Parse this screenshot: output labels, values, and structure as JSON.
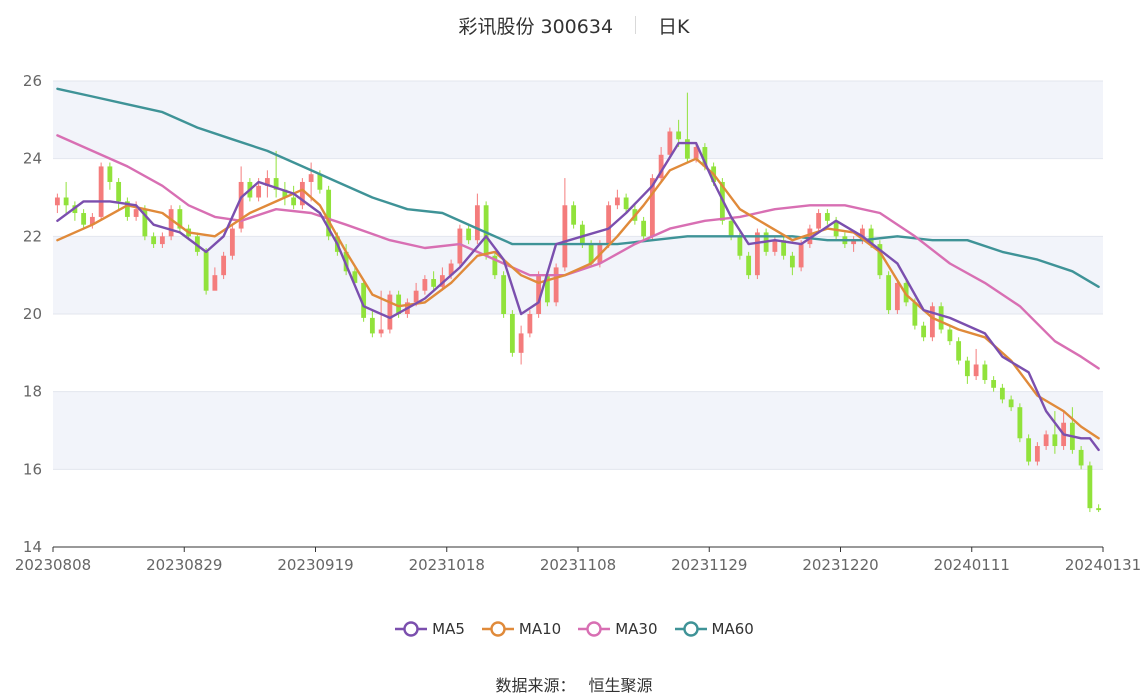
{
  "header": {
    "stock": "彩讯股份 300634",
    "period": "日K"
  },
  "source": {
    "label": "数据来源：",
    "provider": "恒生聚源"
  },
  "chart_data": {
    "type": "candlestick",
    "ylim": [
      14,
      26
    ],
    "yticks": [
      14,
      16,
      18,
      20,
      22,
      24,
      26
    ],
    "xticks": [
      "20230808",
      "20230829",
      "20230919",
      "20231018",
      "20231108",
      "20231129",
      "20231220",
      "20240111",
      "20240131"
    ],
    "n_candles": 120,
    "colors": {
      "up": "#f47c7c",
      "down": "#91e23b",
      "band": "#f2f4fa",
      "ma5": "#7b4fae",
      "ma10": "#e08a3a",
      "ma30": "#d86fb3",
      "ma60": "#3f9397"
    },
    "candles": [
      [
        22.8,
        23.0,
        22.6,
        23.1
      ],
      [
        23.0,
        22.8,
        22.6,
        23.4
      ],
      [
        22.8,
        22.6,
        22.4,
        22.9
      ],
      [
        22.6,
        22.3,
        22.2,
        22.7
      ],
      [
        22.3,
        22.5,
        22.2,
        22.6
      ],
      [
        22.5,
        23.8,
        22.4,
        23.9
      ],
      [
        23.8,
        23.4,
        23.2,
        23.9
      ],
      [
        23.4,
        22.9,
        22.7,
        23.5
      ],
      [
        22.9,
        22.5,
        22.4,
        23.0
      ],
      [
        22.5,
        22.7,
        22.4,
        22.9
      ],
      [
        22.7,
        22.0,
        21.9,
        22.8
      ],
      [
        22.0,
        21.8,
        21.7,
        22.1
      ],
      [
        21.8,
        22.0,
        21.7,
        22.1
      ],
      [
        22.0,
        22.7,
        21.9,
        22.8
      ],
      [
        22.7,
        22.2,
        22.1,
        22.8
      ],
      [
        22.2,
        22.0,
        21.9,
        22.3
      ],
      [
        22.0,
        21.6,
        21.5,
        22.1
      ],
      [
        21.6,
        20.6,
        20.5,
        21.7
      ],
      [
        20.6,
        21.0,
        20.9,
        21.2
      ],
      [
        21.0,
        21.5,
        20.9,
        21.6
      ],
      [
        21.5,
        22.2,
        21.4,
        22.3
      ],
      [
        22.2,
        23.4,
        22.1,
        23.8
      ],
      [
        23.4,
        23.0,
        22.9,
        23.5
      ],
      [
        23.0,
        23.3,
        22.9,
        23.5
      ],
      [
        23.3,
        23.5,
        23.0,
        23.7
      ],
      [
        23.5,
        23.2,
        23.0,
        24.2
      ],
      [
        23.2,
        23.0,
        22.8,
        23.4
      ],
      [
        23.0,
        22.8,
        22.7,
        23.3
      ],
      [
        22.8,
        23.4,
        22.7,
        23.5
      ],
      [
        23.4,
        23.6,
        22.9,
        23.9
      ],
      [
        23.6,
        23.2,
        23.1,
        23.7
      ],
      [
        23.2,
        22.0,
        21.9,
        23.3
      ],
      [
        22.0,
        21.6,
        21.5,
        22.1
      ],
      [
        21.6,
        21.1,
        21.0,
        21.8
      ],
      [
        21.1,
        20.8,
        20.7,
        21.2
      ],
      [
        20.8,
        19.9,
        19.8,
        20.9
      ],
      [
        19.9,
        19.5,
        19.4,
        20.1
      ],
      [
        19.5,
        19.6,
        19.4,
        20.6
      ],
      [
        19.6,
        20.5,
        19.5,
        20.6
      ],
      [
        20.5,
        20.0,
        19.9,
        20.6
      ],
      [
        20.0,
        20.3,
        19.9,
        20.4
      ],
      [
        20.3,
        20.6,
        20.2,
        20.8
      ],
      [
        20.6,
        20.9,
        20.5,
        21.0
      ],
      [
        20.9,
        20.7,
        20.6,
        21.1
      ],
      [
        20.7,
        21.0,
        20.6,
        21.2
      ],
      [
        21.0,
        21.3,
        20.9,
        21.4
      ],
      [
        21.3,
        22.2,
        21.2,
        22.3
      ],
      [
        22.2,
        21.9,
        21.8,
        22.3
      ],
      [
        21.9,
        22.8,
        21.8,
        23.1
      ],
      [
        22.8,
        21.5,
        21.4,
        22.9
      ],
      [
        21.5,
        21.0,
        20.9,
        21.6
      ],
      [
        21.0,
        20.0,
        19.9,
        21.1
      ],
      [
        20.0,
        19.0,
        18.9,
        20.1
      ],
      [
        19.0,
        19.5,
        18.7,
        19.7
      ],
      [
        19.5,
        20.0,
        19.4,
        20.1
      ],
      [
        20.0,
        21.0,
        19.9,
        21.1
      ],
      [
        21.0,
        20.3,
        20.2,
        21.1
      ],
      [
        20.3,
        21.2,
        20.2,
        21.3
      ],
      [
        21.2,
        22.8,
        21.1,
        23.5
      ],
      [
        22.8,
        22.3,
        22.2,
        22.9
      ],
      [
        22.3,
        21.8,
        21.7,
        22.4
      ],
      [
        21.8,
        21.3,
        21.2,
        21.9
      ],
      [
        21.3,
        21.8,
        21.2,
        21.9
      ],
      [
        21.8,
        22.8,
        21.7,
        22.9
      ],
      [
        22.8,
        23.0,
        22.7,
        23.2
      ],
      [
        23.0,
        22.7,
        22.6,
        23.1
      ],
      [
        22.7,
        22.4,
        22.3,
        22.8
      ],
      [
        22.4,
        22.0,
        21.9,
        22.5
      ],
      [
        22.0,
        23.5,
        21.9,
        23.6
      ],
      [
        23.5,
        24.1,
        23.4,
        24.3
      ],
      [
        24.1,
        24.7,
        24.0,
        24.8
      ],
      [
        24.7,
        24.5,
        24.3,
        25.0
      ],
      [
        24.5,
        24.0,
        23.9,
        25.7
      ],
      [
        24.0,
        24.3,
        23.9,
        24.4
      ],
      [
        24.3,
        23.8,
        23.7,
        24.4
      ],
      [
        23.8,
        23.4,
        23.3,
        23.9
      ],
      [
        23.4,
        22.4,
        22.3,
        23.5
      ],
      [
        22.4,
        22.0,
        21.9,
        22.5
      ],
      [
        22.0,
        21.5,
        21.4,
        22.1
      ],
      [
        21.5,
        21.0,
        20.9,
        21.6
      ],
      [
        21.0,
        22.1,
        20.9,
        22.2
      ],
      [
        22.1,
        21.6,
        21.5,
        22.2
      ],
      [
        21.6,
        21.9,
        21.5,
        22.0
      ],
      [
        21.9,
        21.5,
        21.4,
        22.0
      ],
      [
        21.5,
        21.2,
        21.0,
        21.6
      ],
      [
        21.2,
        21.8,
        21.1,
        21.9
      ],
      [
        21.8,
        22.2,
        21.7,
        22.3
      ],
      [
        22.2,
        22.6,
        22.1,
        22.7
      ],
      [
        22.6,
        22.4,
        22.3,
        22.7
      ],
      [
        22.4,
        22.0,
        21.9,
        22.5
      ],
      [
        22.0,
        21.8,
        21.7,
        22.1
      ],
      [
        21.8,
        21.9,
        21.6,
        22.0
      ],
      [
        21.9,
        22.2,
        21.8,
        22.3
      ],
      [
        22.2,
        21.8,
        21.7,
        22.3
      ],
      [
        21.8,
        21.0,
        20.9,
        21.9
      ],
      [
        21.0,
        20.1,
        20.0,
        21.1
      ],
      [
        20.1,
        20.8,
        20.0,
        20.9
      ],
      [
        20.8,
        20.3,
        20.2,
        20.9
      ],
      [
        20.3,
        19.7,
        19.6,
        20.4
      ],
      [
        19.7,
        19.4,
        19.3,
        19.8
      ],
      [
        19.4,
        20.2,
        19.3,
        20.3
      ],
      [
        20.2,
        19.6,
        19.5,
        20.3
      ],
      [
        19.6,
        19.3,
        19.2,
        19.7
      ],
      [
        19.3,
        18.8,
        18.7,
        19.4
      ],
      [
        18.8,
        18.4,
        18.2,
        18.9
      ],
      [
        18.4,
        18.7,
        18.3,
        19.1
      ],
      [
        18.7,
        18.3,
        18.2,
        18.8
      ],
      [
        18.3,
        18.1,
        18.0,
        18.4
      ],
      [
        18.1,
        17.8,
        17.7,
        18.2
      ],
      [
        17.8,
        17.6,
        17.5,
        17.9
      ],
      [
        17.6,
        16.8,
        16.7,
        17.7
      ],
      [
        16.8,
        16.2,
        16.1,
        16.9
      ],
      [
        16.2,
        16.6,
        16.1,
        16.7
      ],
      [
        16.6,
        16.9,
        16.5,
        17.0
      ],
      [
        16.9,
        16.6,
        16.4,
        17.5
      ],
      [
        16.6,
        17.2,
        16.5,
        17.5
      ],
      [
        17.2,
        16.5,
        16.4,
        17.6
      ],
      [
        16.5,
        16.1,
        16.0,
        16.6
      ],
      [
        16.1,
        15.0,
        14.9,
        16.2
      ],
      [
        15.0,
        14.95,
        14.9,
        15.1
      ]
    ],
    "ma5": [
      [
        0,
        22.4
      ],
      [
        3,
        22.9
      ],
      [
        6,
        22.9
      ],
      [
        9,
        22.8
      ],
      [
        11,
        22.3
      ],
      [
        14,
        22.1
      ],
      [
        17,
        21.6
      ],
      [
        19,
        22.0
      ],
      [
        21,
        23.0
      ],
      [
        23,
        23.4
      ],
      [
        27,
        23.1
      ],
      [
        30,
        22.6
      ],
      [
        32,
        21.8
      ],
      [
        35,
        20.2
      ],
      [
        38,
        19.9
      ],
      [
        42,
        20.4
      ],
      [
        46,
        21.2
      ],
      [
        49,
        22.0
      ],
      [
        51,
        21.4
      ],
      [
        53,
        20.0
      ],
      [
        55,
        20.3
      ],
      [
        57,
        21.8
      ],
      [
        60,
        22.0
      ],
      [
        63,
        22.2
      ],
      [
        65,
        22.6
      ],
      [
        68,
        23.3
      ],
      [
        71,
        24.4
      ],
      [
        73,
        24.4
      ],
      [
        75,
        23.4
      ],
      [
        77,
        22.5
      ],
      [
        79,
        21.8
      ],
      [
        82,
        21.9
      ],
      [
        85,
        21.8
      ],
      [
        89,
        22.4
      ],
      [
        92,
        22.0
      ],
      [
        96,
        21.3
      ],
      [
        99,
        20.1
      ],
      [
        102,
        19.9
      ],
      [
        106,
        19.5
      ],
      [
        108,
        18.9
      ],
      [
        111,
        18.5
      ],
      [
        113,
        17.5
      ],
      [
        115,
        16.9
      ],
      [
        117,
        16.8
      ],
      [
        118,
        16.8
      ],
      [
        119,
        16.5
      ]
    ],
    "ma10": [
      [
        0,
        21.9
      ],
      [
        4,
        22.3
      ],
      [
        8,
        22.8
      ],
      [
        12,
        22.6
      ],
      [
        15,
        22.1
      ],
      [
        18,
        22.0
      ],
      [
        22,
        22.6
      ],
      [
        25,
        22.9
      ],
      [
        28,
        23.2
      ],
      [
        30,
        22.8
      ],
      [
        33,
        21.6
      ],
      [
        36,
        20.5
      ],
      [
        39,
        20.2
      ],
      [
        42,
        20.3
      ],
      [
        45,
        20.8
      ],
      [
        48,
        21.5
      ],
      [
        50,
        21.6
      ],
      [
        53,
        21.0
      ],
      [
        55,
        20.8
      ],
      [
        58,
        21.0
      ],
      [
        61,
        21.3
      ],
      [
        64,
        22.0
      ],
      [
        67,
        22.8
      ],
      [
        70,
        23.7
      ],
      [
        73,
        24.0
      ],
      [
        75,
        23.6
      ],
      [
        78,
        22.7
      ],
      [
        81,
        22.3
      ],
      [
        84,
        21.9
      ],
      [
        88,
        22.2
      ],
      [
        91,
        22.1
      ],
      [
        94,
        21.6
      ],
      [
        97,
        20.5
      ],
      [
        100,
        19.9
      ],
      [
        103,
        19.6
      ],
      [
        106,
        19.4
      ],
      [
        109,
        18.8
      ],
      [
        112,
        17.9
      ],
      [
        115,
        17.5
      ],
      [
        117,
        17.1
      ],
      [
        119,
        16.8
      ]
    ],
    "ma30": [
      [
        0,
        24.6
      ],
      [
        4,
        24.2
      ],
      [
        8,
        23.8
      ],
      [
        12,
        23.3
      ],
      [
        15,
        22.8
      ],
      [
        18,
        22.5
      ],
      [
        21,
        22.4
      ],
      [
        25,
        22.7
      ],
      [
        29,
        22.6
      ],
      [
        33,
        22.3
      ],
      [
        38,
        21.9
      ],
      [
        42,
        21.7
      ],
      [
        46,
        21.8
      ],
      [
        50,
        21.4
      ],
      [
        54,
        21.0
      ],
      [
        58,
        21.0
      ],
      [
        62,
        21.3
      ],
      [
        66,
        21.8
      ],
      [
        70,
        22.2
      ],
      [
        74,
        22.4
      ],
      [
        78,
        22.5
      ],
      [
        82,
        22.7
      ],
      [
        86,
        22.8
      ],
      [
        90,
        22.8
      ],
      [
        94,
        22.6
      ],
      [
        98,
        22.0
      ],
      [
        102,
        21.3
      ],
      [
        106,
        20.8
      ],
      [
        110,
        20.2
      ],
      [
        114,
        19.3
      ],
      [
        117,
        18.9
      ],
      [
        119,
        18.6
      ]
    ],
    "ma60": [
      [
        0,
        25.8
      ],
      [
        4,
        25.6
      ],
      [
        8,
        25.4
      ],
      [
        12,
        25.2
      ],
      [
        16,
        24.8
      ],
      [
        20,
        24.5
      ],
      [
        24,
        24.2
      ],
      [
        28,
        23.8
      ],
      [
        32,
        23.4
      ],
      [
        36,
        23.0
      ],
      [
        40,
        22.7
      ],
      [
        44,
        22.6
      ],
      [
        48,
        22.2
      ],
      [
        52,
        21.8
      ],
      [
        56,
        21.8
      ],
      [
        60,
        21.8
      ],
      [
        64,
        21.8
      ],
      [
        68,
        21.9
      ],
      [
        72,
        22.0
      ],
      [
        76,
        22.0
      ],
      [
        80,
        22.0
      ],
      [
        84,
        22.0
      ],
      [
        88,
        21.9
      ],
      [
        92,
        21.9
      ],
      [
        96,
        22.0
      ],
      [
        100,
        21.9
      ],
      [
        104,
        21.9
      ],
      [
        108,
        21.6
      ],
      [
        112,
        21.4
      ],
      [
        116,
        21.1
      ],
      [
        119,
        20.7
      ]
    ],
    "legend": [
      {
        "key": "ma5",
        "label": "MA5"
      },
      {
        "key": "ma10",
        "label": "MA10"
      },
      {
        "key": "ma30",
        "label": "MA30"
      },
      {
        "key": "ma60",
        "label": "MA60"
      }
    ]
  }
}
